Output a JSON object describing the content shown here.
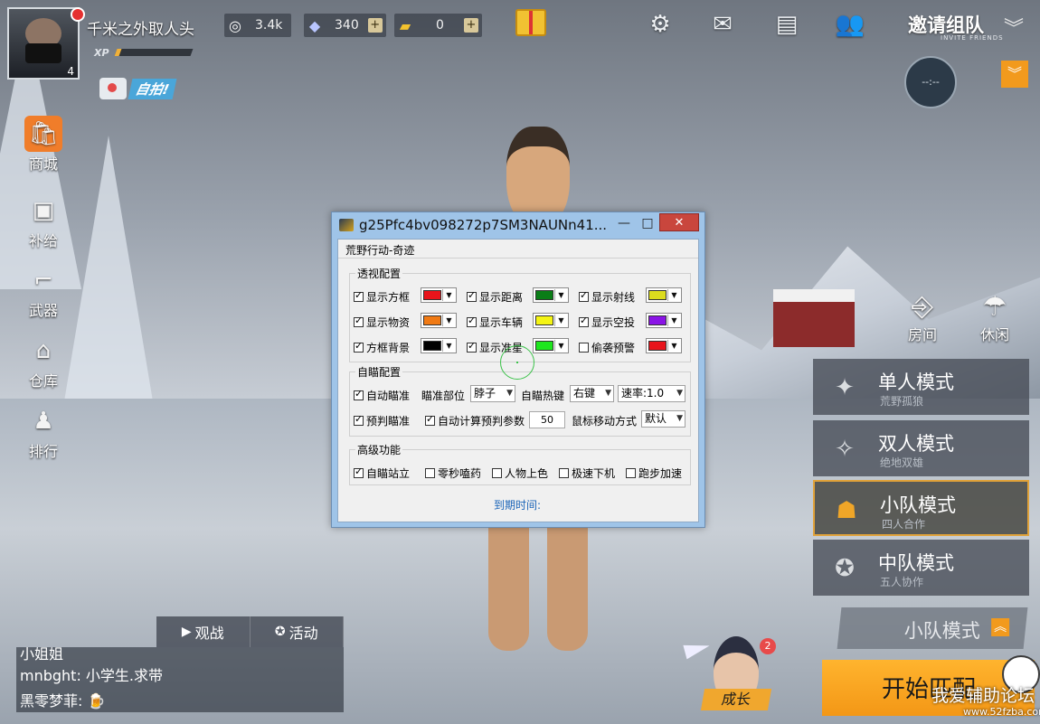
{
  "player": {
    "name": "千米之外取人头",
    "level": "4",
    "xp_label": "XP",
    "xp_progress": 0.06
  },
  "currencies": [
    {
      "icon": "coin-icon",
      "value": "3.4k",
      "has_plus": false
    },
    {
      "icon": "diamond-icon",
      "value": "340",
      "has_plus": true
    },
    {
      "icon": "ticket-icon",
      "value": "0",
      "has_plus": true
    }
  ],
  "plus_label": "+",
  "invite": {
    "label": "邀请组队",
    "sub": "INVITE FRIENDS"
  },
  "compass": {
    "text": "--:--"
  },
  "selfie": {
    "label": "自拍!"
  },
  "side_nav": [
    {
      "key": "shop",
      "label": "商城",
      "icon": "shop-bag-icon"
    },
    {
      "key": "supply",
      "label": "补给",
      "icon": "supply-crate-icon"
    },
    {
      "key": "weapons",
      "label": "武器",
      "icon": "gun-icon"
    },
    {
      "key": "warehouse",
      "label": "仓库",
      "icon": "warehouse-icon"
    },
    {
      "key": "ranking",
      "label": "排行",
      "icon": "ranking-people-icon"
    }
  ],
  "right_buttons": [
    {
      "key": "room",
      "label": "房间",
      "icon": "door-icon"
    },
    {
      "key": "casual",
      "label": "休闲",
      "icon": "parachute-icon"
    }
  ],
  "modes": [
    {
      "title": "单人模式",
      "sub": "荒野孤狼",
      "active": false,
      "icon": "solo-soldier-icon"
    },
    {
      "title": "双人模式",
      "sub": "绝地双雄",
      "active": false,
      "icon": "duo-soldier-icon"
    },
    {
      "title": "小队模式",
      "sub": "四人合作",
      "active": true,
      "icon": "squad-icon"
    },
    {
      "title": "中队模式",
      "sub": "五人协作",
      "active": false,
      "icon": "star-emblem-icon"
    }
  ],
  "selected_mode": "小队模式",
  "start_button": "开始匹配",
  "growth": {
    "label": "成长",
    "badge": "2"
  },
  "bottom_tabs": [
    {
      "label": "观战",
      "icon": "play-icon"
    },
    {
      "label": "活动",
      "icon": "star-circle-icon"
    }
  ],
  "chat": [
    "小姐姐",
    "mnbght: 小学生.求带",
    "黑零梦菲: 🍺"
  ],
  "watermark": {
    "text": "我爱辅助论坛",
    "url": "www.52fzba.com"
  },
  "cheat_window": {
    "title": "g25Pfc4bv098272p7SM3NAUNn41...",
    "minimize": "—",
    "maximize": "□",
    "close": "✕",
    "subtitle": "荒野行动-奇迹",
    "groups": {
      "esp": {
        "title": "透视配置",
        "items": [
          {
            "label": "显示方框",
            "checked": true,
            "color": "#e8141b"
          },
          {
            "label": "显示距离",
            "checked": true,
            "color": "#0a7d17"
          },
          {
            "label": "显示射线",
            "checked": true,
            "color": "#dcdc1e"
          },
          {
            "label": "显示物资",
            "checked": true,
            "color": "#f07a14"
          },
          {
            "label": "显示车辆",
            "checked": true,
            "color": "#f4f414"
          },
          {
            "label": "显示空投",
            "checked": true,
            "color": "#8a14e6"
          },
          {
            "label": "方框背景",
            "checked": true,
            "color": "#000000"
          },
          {
            "label": "显示准星",
            "checked": true,
            "color": "#1ee61e"
          },
          {
            "label": "偷袭预警",
            "checked": false,
            "color": "#e8141b"
          }
        ]
      },
      "aim": {
        "title": "自瞄配置",
        "auto_aim": {
          "label": "自动瞄准",
          "checked": true
        },
        "aim_part_label": "瞄准部位",
        "aim_part_value": "脖子",
        "hotkey_label": "自瞄热键",
        "hotkey_value": "右键",
        "speed_value": "速率:1.0",
        "predict": {
          "label": "预判瞄准",
          "checked": true
        },
        "auto_calc": {
          "label": "自动计算预判参数",
          "checked": true
        },
        "param_value": "50",
        "mouse_mode_label": "鼠标移动方式",
        "mouse_mode_value": "默认"
      },
      "advanced": {
        "title": "高级功能",
        "items": [
          {
            "label": "自瞄站立",
            "checked": true
          },
          {
            "label": "零秒嗑药",
            "checked": false
          },
          {
            "label": "人物上色",
            "checked": false
          },
          {
            "label": "极速下机",
            "checked": false
          },
          {
            "label": "跑步加速",
            "checked": false
          }
        ]
      }
    },
    "expiry_label": "到期时间:"
  },
  "colors": {
    "accent": "#f29a1d",
    "active_border": "#e0a23a",
    "window_frame": "#9fc4e8"
  }
}
